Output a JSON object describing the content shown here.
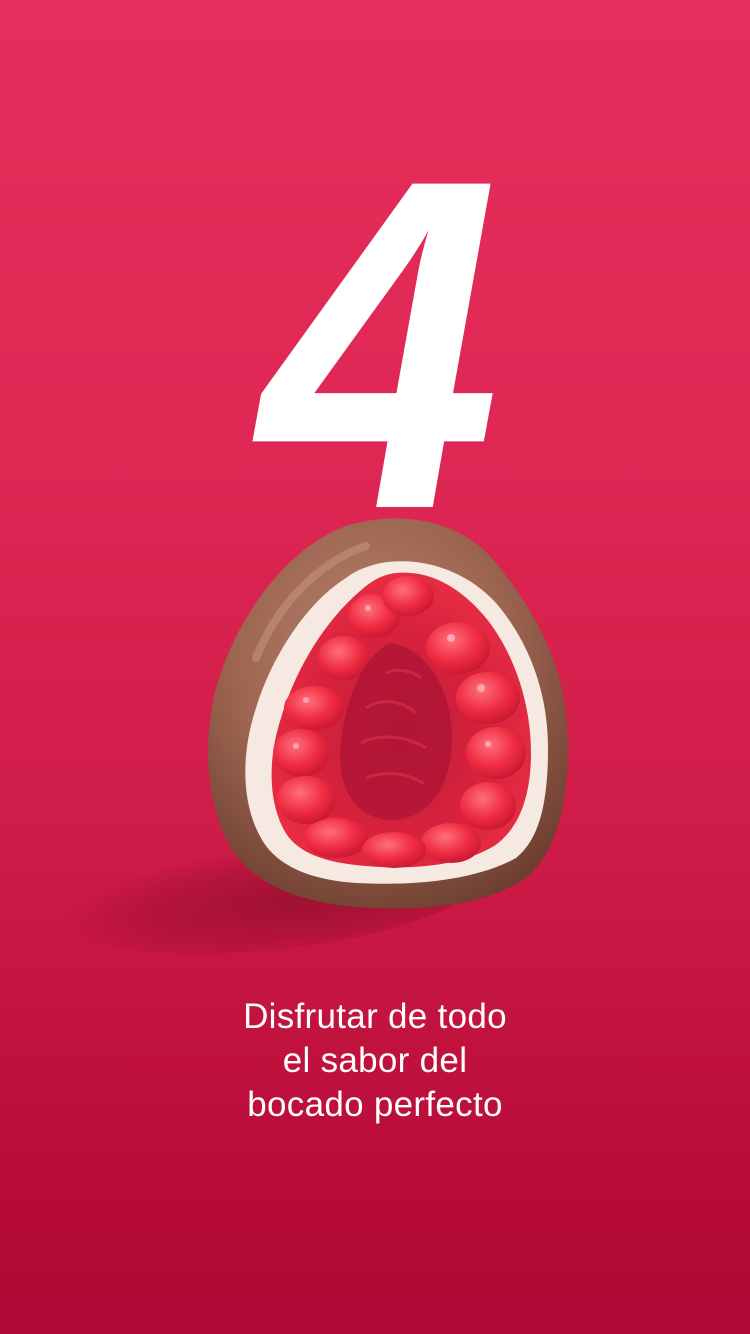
{
  "slide": {
    "number": "4",
    "caption_lines": [
      "Disfrutar de todo",
      "el sabor del",
      "bocado perfecto"
    ]
  },
  "colors": {
    "background_top": "#e62e5c",
    "background_bottom": "#af0834",
    "text": "#ffffff",
    "milk_chocolate": "#9c6550",
    "white_chocolate": "#f6e9e2",
    "raspberry": "#e8293e"
  },
  "icons": {
    "product_image": "chocolate-covered-raspberry-image"
  }
}
